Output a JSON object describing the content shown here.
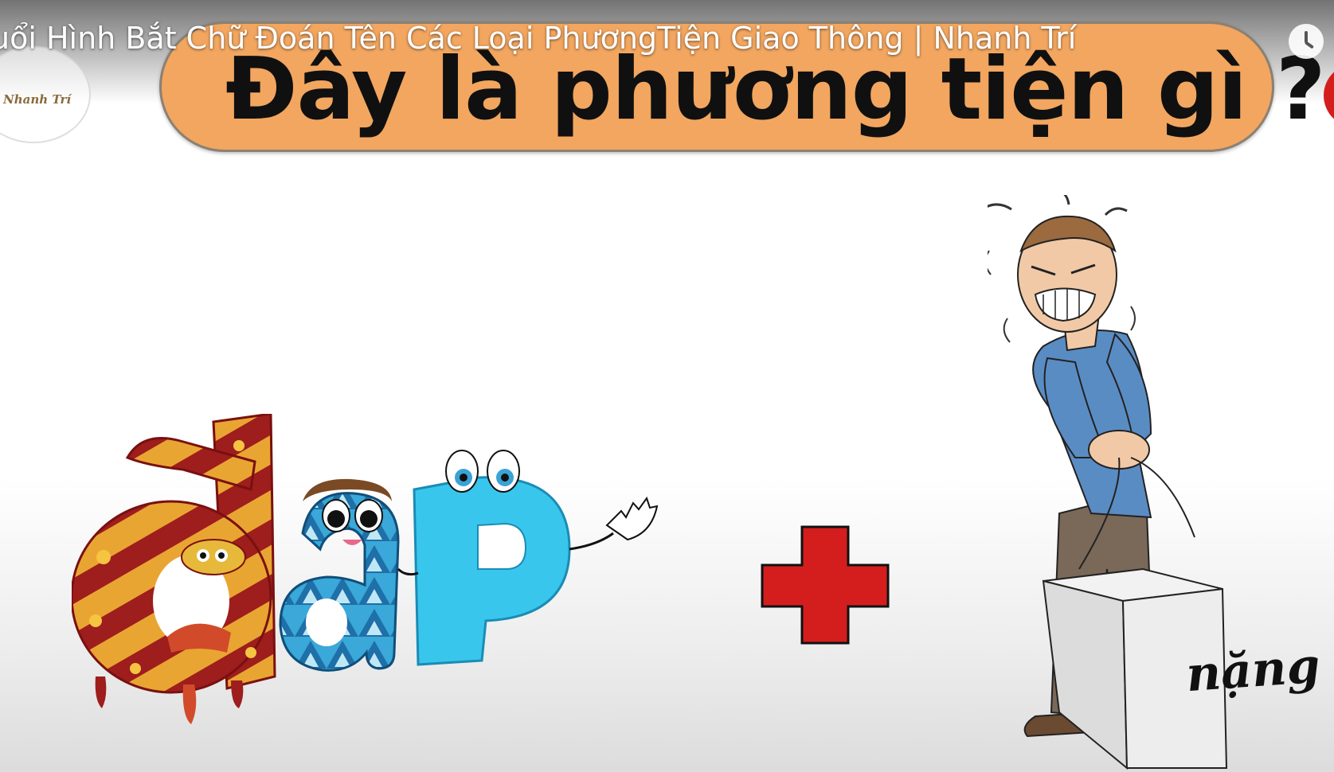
{
  "video": {
    "title": "uổi Hình Bắt Chữ Đoán Tên Các Loại PhươngTiện Giao Thông | Nhanh Trí"
  },
  "channel_logo": {
    "text": "Nhanh Trí"
  },
  "quiz": {
    "question": "Đây là phương tiện gì ?",
    "word_letters": [
      "đ",
      "a",
      "P"
    ],
    "box_label": "nặng"
  },
  "icons": {
    "watch_later": "clock-icon",
    "plus": "plus-icon"
  },
  "colors": {
    "banner": "#f2a65f",
    "plus": "#d41e1e",
    "letter_d": "#e0a030",
    "letter_a": "#3aa8d8",
    "letter_p": "#39c6ec"
  }
}
